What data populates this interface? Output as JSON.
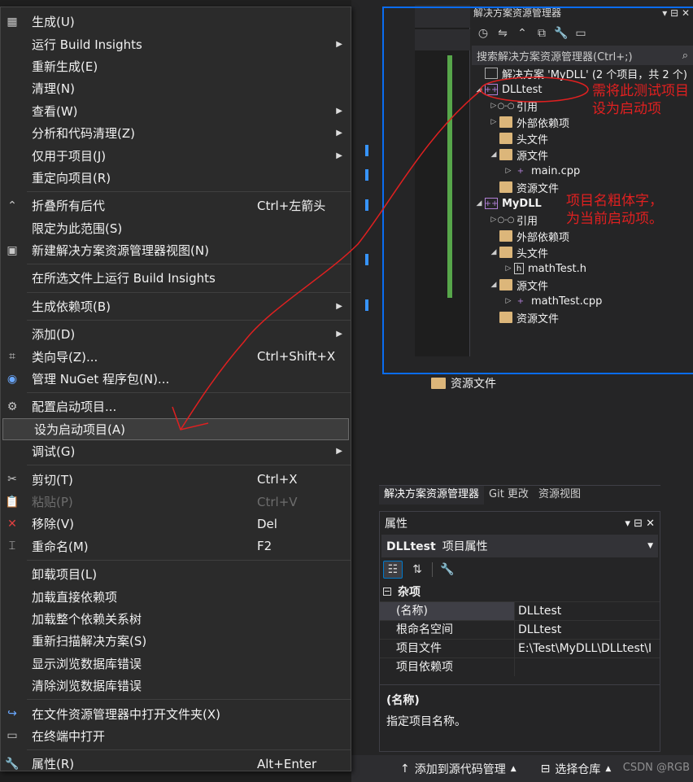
{
  "context_menu": {
    "items": [
      {
        "icon": "build-icon",
        "label": "生成(U)",
        "shortcut": "",
        "submenu": false
      },
      {
        "icon": "",
        "label": "运行 Build Insights",
        "shortcut": "",
        "submenu": true
      },
      {
        "icon": "",
        "label": "重新生成(E)",
        "shortcut": "",
        "submenu": false
      },
      {
        "icon": "",
        "label": "清理(N)",
        "shortcut": "",
        "submenu": false
      },
      {
        "icon": "",
        "label": "查看(W)",
        "shortcut": "",
        "submenu": true
      },
      {
        "icon": "",
        "label": "分析和代码清理(Z)",
        "shortcut": "",
        "submenu": true
      },
      {
        "icon": "",
        "label": "仅用于项目(J)",
        "shortcut": "",
        "submenu": true
      },
      {
        "icon": "",
        "label": "重定向项目(R)",
        "shortcut": "",
        "submenu": false
      },
      {
        "icon": "collapse-icon",
        "label": "折叠所有后代",
        "shortcut": "Ctrl+左箭头",
        "submenu": false
      },
      {
        "icon": "",
        "label": "限定为此范围(S)",
        "shortcut": "",
        "submenu": false
      },
      {
        "icon": "new-view-icon",
        "label": "新建解决方案资源管理器视图(N)",
        "shortcut": "",
        "submenu": false
      },
      {
        "icon": "",
        "label": "在所选文件上运行 Build Insights",
        "shortcut": "",
        "submenu": false
      },
      {
        "icon": "",
        "label": "生成依赖项(B)",
        "shortcut": "",
        "submenu": true
      },
      {
        "icon": "",
        "label": "添加(D)",
        "shortcut": "",
        "submenu": true
      },
      {
        "icon": "class-wizard-icon",
        "label": "类向导(Z)...",
        "shortcut": "Ctrl+Shift+X",
        "submenu": false
      },
      {
        "icon": "nuget-icon",
        "label": "管理 NuGet 程序包(N)...",
        "shortcut": "",
        "submenu": false
      },
      {
        "icon": "gear-icon",
        "label": "配置启动项目...",
        "shortcut": "",
        "submenu": false
      },
      {
        "icon": "",
        "label": "设为启动项目(A)",
        "shortcut": "",
        "submenu": false
      },
      {
        "icon": "",
        "label": "调试(G)",
        "shortcut": "",
        "submenu": true
      },
      {
        "icon": "scissors-icon",
        "label": "剪切(T)",
        "shortcut": "Ctrl+X",
        "submenu": false
      },
      {
        "icon": "paste-icon",
        "label": "粘贴(P)",
        "shortcut": "Ctrl+V",
        "submenu": false
      },
      {
        "icon": "remove-icon",
        "label": "移除(V)",
        "shortcut": "Del",
        "submenu": false
      },
      {
        "icon": "rename-icon",
        "label": "重命名(M)",
        "shortcut": "F2",
        "submenu": false
      },
      {
        "icon": "",
        "label": "卸载项目(L)",
        "shortcut": "",
        "submenu": false
      },
      {
        "icon": "",
        "label": "加载直接依赖项",
        "shortcut": "",
        "submenu": false
      },
      {
        "icon": "",
        "label": "加载整个依赖关系树",
        "shortcut": "",
        "submenu": false
      },
      {
        "icon": "",
        "label": "重新扫描解决方案(S)",
        "shortcut": "",
        "submenu": false
      },
      {
        "icon": "",
        "label": "显示浏览数据库错误",
        "shortcut": "",
        "submenu": false
      },
      {
        "icon": "",
        "label": "清除浏览数据库错误",
        "shortcut": "",
        "submenu": false
      },
      {
        "icon": "open-folder-icon",
        "label": "在文件资源管理器中打开文件夹(X)",
        "shortcut": "",
        "submenu": false
      },
      {
        "icon": "terminal-icon",
        "label": "在终端中打开",
        "shortcut": "",
        "submenu": false
      },
      {
        "icon": "wrench-icon",
        "label": "属性(R)",
        "shortcut": "Alt+Enter",
        "submenu": false
      }
    ]
  },
  "solution_explorer": {
    "title": "解决方案资源管理器",
    "title_controls": "▾ ⊟ ✕",
    "search_placeholder": "搜索解决方案资源管理器(Ctrl+;)",
    "search_icon": "search-icon",
    "tree": [
      {
        "level": 0,
        "arrow": "",
        "icon": "solution-icon",
        "label": "解决方案 'MyDLL' (2 个项目，共 2 个)",
        "bold": false
      },
      {
        "level": 0,
        "arrow": "◢",
        "icon": "project-icon",
        "label": "DLLtest",
        "bold": false
      },
      {
        "level": 1,
        "arrow": "▷",
        "icon": "references-icon",
        "label": "引用",
        "bold": false
      },
      {
        "level": 1,
        "arrow": "▷",
        "icon": "folder-icon",
        "label": "外部依赖项",
        "bold": false
      },
      {
        "level": 1,
        "arrow": "",
        "icon": "folder-icon",
        "label": "头文件",
        "bold": false
      },
      {
        "level": 1,
        "arrow": "◢",
        "icon": "folder-icon",
        "label": "源文件",
        "bold": false
      },
      {
        "level": 2,
        "arrow": "▷",
        "icon": "cpp-icon",
        "label": "main.cpp",
        "bold": false
      },
      {
        "level": 1,
        "arrow": "",
        "icon": "folder-icon",
        "label": "资源文件",
        "bold": false
      },
      {
        "level": 0,
        "arrow": "◢",
        "icon": "project-icon",
        "label": "MyDLL",
        "bold": true
      },
      {
        "level": 1,
        "arrow": "▷",
        "icon": "references-icon",
        "label": "引用",
        "bold": false
      },
      {
        "level": 1,
        "arrow": "",
        "icon": "folder-icon",
        "label": "外部依赖项",
        "bold": false
      },
      {
        "level": 1,
        "arrow": "◢",
        "icon": "folder-icon",
        "label": "头文件",
        "bold": false
      },
      {
        "level": 2,
        "arrow": "▷",
        "icon": "header-icon",
        "label": "mathTest.h",
        "bold": false
      },
      {
        "level": 1,
        "arrow": "◢",
        "icon": "folder-icon",
        "label": "源文件",
        "bold": false
      },
      {
        "level": 2,
        "arrow": "▷",
        "icon": "cpp-icon",
        "label": "mathTest.cpp",
        "bold": false
      },
      {
        "level": 1,
        "arrow": "",
        "icon": "folder-icon",
        "label": "资源文件",
        "bold": false
      }
    ]
  },
  "annotations": {
    "note1_line1": "需将此测试项目",
    "note1_line2": "设为启动项",
    "note2_line1": "项目名粗体字，",
    "note2_line2": "为当前启动项。",
    "color": "#e02020"
  },
  "background": {
    "behind_item_label": "资源文件",
    "tabs": [
      "解决方案资源管理器",
      "Git 更改",
      "资源视图"
    ]
  },
  "properties": {
    "title": "属性",
    "title_controls": "▾ ⊟ ✕",
    "object_name": "DLLtest",
    "object_type": "项目属性",
    "category": "杂项",
    "rows": [
      {
        "key": "(名称)",
        "value": "DLLtest"
      },
      {
        "key": "根命名空间",
        "value": "DLLtest"
      },
      {
        "key": "项目文件",
        "value": "E:\\Test\\MyDLL\\DLLtest\\I"
      },
      {
        "key": "项目依赖项",
        "value": ""
      }
    ],
    "desc_title": "(名称)",
    "desc_text": "指定项目名称。"
  },
  "status_bar": {
    "source_control": "添加到源代码管理",
    "select_repo": "选择仓库",
    "watermark": "CSDN @RGB"
  },
  "colors": {
    "accent_blue": "#0a6cf0",
    "menu_bg": "#2b2b2b",
    "green_change_bar": "#57a64a"
  }
}
